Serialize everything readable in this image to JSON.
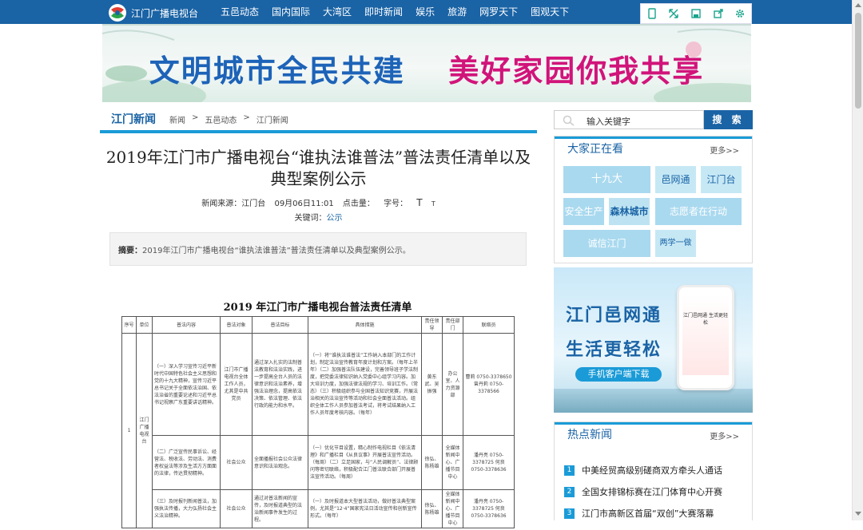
{
  "header": {
    "logo_text": "江门广播电视台",
    "nav": [
      "五邑动态",
      "国内国际",
      "大湾区",
      "即时新闻",
      "娱乐",
      "旅游",
      "网罗天下",
      "图观天下"
    ],
    "tools": [
      "mobile-icon",
      "expand-icon",
      "save-icon",
      "share-icon",
      "settings-icon"
    ]
  },
  "banner": {
    "part1": "文明城市全民共建",
    "part2": "美好家园你我共享"
  },
  "breadcrumb": {
    "section_title": "江门新闻",
    "items": [
      "新闻",
      "五邑动态",
      "江门新闻"
    ]
  },
  "article": {
    "title": "2019年江门市广播电视台“谁执法谁普法”普法责任清单以及典型案例公示",
    "source": "新闻来源：江门台",
    "date": "09月06日11:01",
    "clicks_label": "点击量：",
    "font_label": "字号：",
    "font_big": "T",
    "font_small": "T",
    "keywords_label": "关键词：",
    "keyword": "公示",
    "summary_label": "摘要：",
    "summary": "2019年江门市广播电视台“谁执法谁普法”普法责任清单以及典型案例公示。"
  },
  "document": {
    "title": "2019 年江门市广播电视台普法责任清单",
    "headers": [
      "序号",
      "单位",
      "普法内容",
      "普法对象",
      "普法目标",
      "具体措施",
      "责任领导",
      "责任部门",
      "联络员"
    ],
    "seq": "1",
    "unit": "江门广播电视台",
    "rows": [
      {
        "content": "（一）深入学习宣传习近平新时代中国特色社会主义思想和党的十九大精神，宣传习近平总书记关于全面依法治国、依法治省的重要论述和习近平总书记视察广东重要讲话精神。",
        "target": "江门市广播电视台全体工作人员，尤其是中共党员",
        "goal": "通过深入扎实的法制普法教育和法治实践，进一步提高全台人员的法律意识和法治素养，增强法治理念，提高依法决策、依法管理、依法行政的能力和水平。",
        "measures": "（一）将“谁执法谁普法”工作纳入本部门的工作计划，制定法治宣传教育年度计划和方案。（每年上半年）（二）加强普法队伍建设，完善领导班子学法制度，把党委法律知识纳入党委中心组学习内容。加大培训力度，加强法律法规的学习、培训工作。（常态）（三）积极组织参与全国普法知识竞赛，开展法治相关的法治宣传等活动和社会全面普法活动。组织全体工作人员参加普法考试，将考试结果纳入工作人员年度考核内容。（每年）",
        "leader": "黄东武、吴振强",
        "dept": "办公室、人力资源部",
        "contact": "曹莉 0750-3378650 曾丹莉 0750-3378566"
      },
      {
        "content": "（二）广泛宣传民事诉讼、经营法、税收法、劳动法、消费者权益法等涉及生活方方面面的法律，传达贯彻精神。",
        "target": "社会公众",
        "goal": "全面播报社会公众法律意识和法治观念。",
        "measures": "（一）优化节目设置，精心制作电视栏目《依法清理》和广播栏目《从良议事》开展普法宣传活动。（每周）（二）立足国家，与“人民调解员”、法律顾问等密切联络，积极配合江门普法联合部门开展普法宣传活动。（每周）",
        "leader": "徐弘、陈杨雄",
        "dept": "全媒体新闻中心、广播节目中心",
        "contact": "潘丹亮 0750-3378725 何良 0750-3378636"
      },
      {
        "content": "（三）及时报刊新闻普法，加强执法传播，大力弘扬社会主义法治精神。",
        "target": "社会公众",
        "goal": "通过对普法新闻的宣传，及时报道典型的法治新闻事件发生的过程。",
        "measures": "（一）及时报道本大型普法活动，做好普法典型案例，尤其是“12·4”国家宪法日活动宣传和创新宣传形式。（每年）",
        "leader": "徐弘、陈杨雄",
        "dept": "全媒体新闻中心、广播节目中心",
        "contact": "潘丹亮 0750-3378725 何良 0750-3378636"
      }
    ]
  },
  "search": {
    "placeholder": "输入关键字",
    "button": "搜 索"
  },
  "trending": {
    "title": "大家正在看",
    "more": "更多>>",
    "tags": [
      "十九大",
      "邑网通",
      "江门台",
      "安全生产",
      "森林城市",
      "志愿者在行动",
      "诚信江门",
      "两学一做"
    ]
  },
  "ad": {
    "line1": "江门邑网通",
    "line2": "生活更轻松",
    "button": "手机客户端下载",
    "phone_title": "江门邑网通 生活更轻松"
  },
  "hot": {
    "title": "热点新闻",
    "more": "更多>>",
    "items": [
      {
        "num": "1",
        "text": "中美经贸高级别磋商双方牵头人通话"
      },
      {
        "num": "2",
        "text": "全国女排锦标赛在江门体育中心开赛"
      },
      {
        "num": "3",
        "text": "江门市高新区首届“双创”大赛落幕"
      }
    ]
  },
  "colors": {
    "brand": "#1a63a5",
    "accent": "#1a9bd7",
    "banner_blue": "#1d63b8",
    "banner_pink": "#d1147a"
  }
}
